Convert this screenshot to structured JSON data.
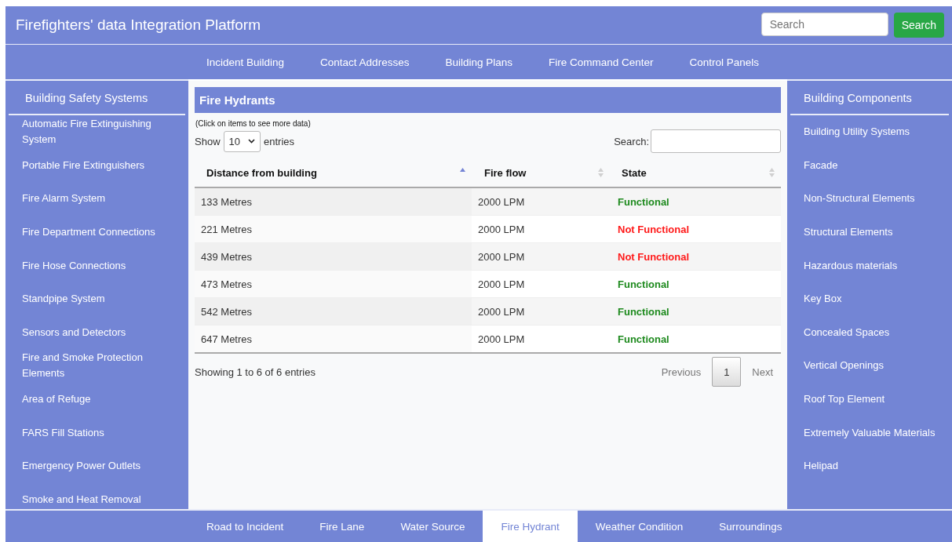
{
  "header": {
    "title": "Firefighters' data Integration Platform",
    "search": {
      "placeholder": "Search"
    },
    "search_button": "Search"
  },
  "top_nav": [
    "Incident Building",
    "Contact Addresses",
    "Building Plans",
    "Fire Command Center",
    "Control Panels"
  ],
  "left_sidebar": {
    "heading": "Building Safety Systems",
    "items": [
      "Automatic Fire Extinguishing System",
      "Portable Fire Extinguishers",
      "Fire Alarm System",
      "Fire Department Connections",
      "Fire Hose Connections",
      "Standpipe System",
      "Sensors and Detectors",
      "Fire and Smoke Protection Elements",
      "Area of Refuge",
      "FARS Fill Stations",
      "Emergency Power Outlets",
      "Smoke and Heat Removal"
    ]
  },
  "panel": {
    "title": "Fire Hydrants",
    "hint": "(Click on items to see more data)",
    "show_label": "Show",
    "page_size": "10",
    "entries_label": "entries",
    "search_label": "Search:",
    "table": {
      "columns": [
        {
          "label": "Distance from building",
          "sorted": true
        },
        {
          "label": "Fire flow",
          "sorted": false
        },
        {
          "label": "State",
          "sorted": false
        }
      ],
      "rows": [
        {
          "distance": "133 Metres",
          "flow": "2000 LPM",
          "state": "Functional",
          "color": "#1e8a1e"
        },
        {
          "distance": "221 Metres",
          "flow": "2000 LPM",
          "state": "Not Functional",
          "color": "#ff1a1a"
        },
        {
          "distance": "439 Metres",
          "flow": "2000 LPM",
          "state": "Not Functional",
          "color": "#ff1a1a"
        },
        {
          "distance": "473 Metres",
          "flow": "2000 LPM",
          "state": "Functional",
          "color": "#1e8a1e"
        },
        {
          "distance": "542 Metres",
          "flow": "2000 LPM",
          "state": "Functional",
          "color": "#1e8a1e"
        },
        {
          "distance": "647 Metres",
          "flow": "2000 LPM",
          "state": "Functional",
          "color": "#1e8a1e"
        }
      ]
    },
    "info": "Showing 1 to 6 of 6 entries",
    "previous": {
      "label": "Previous",
      "disabled": true
    },
    "pages": [
      {
        "label": "1",
        "selected": true
      }
    ],
    "next": {
      "label": "Next",
      "disabled": true
    }
  },
  "right_sidebar": {
    "heading": "Building Components",
    "items": [
      "Building Utility Systems",
      "Facade",
      "Non-Structural Elements",
      "Structural Elements",
      "Hazardous materials",
      "Key Box",
      "Concealed Spaces",
      "Vertical Openings",
      "Roof Top Element",
      "Extremely Valuable Materials",
      "Helipad"
    ]
  },
  "bottom_nav": [
    {
      "label": "Road to Incident",
      "selected": false
    },
    {
      "label": "Fire Lane",
      "selected": false
    },
    {
      "label": "Water Source",
      "selected": false
    },
    {
      "label": "Fire Hydrant",
      "selected": true
    },
    {
      "label": "Weather Condition",
      "selected": false
    },
    {
      "label": "Surroundings",
      "selected": false
    }
  ]
}
